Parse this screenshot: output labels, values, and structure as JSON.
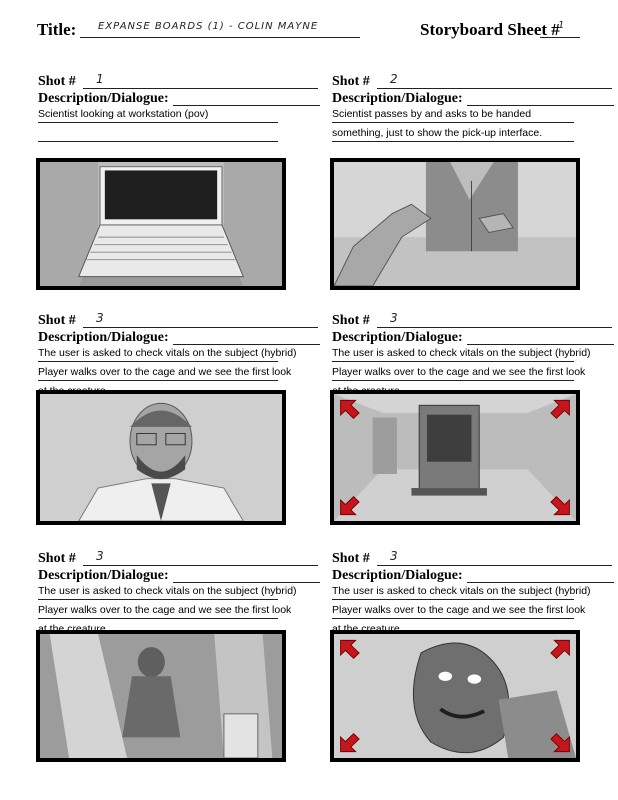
{
  "header": {
    "title_label": "Title:",
    "title_value": "EXPANSE BOARDS (1)  - COLIN MAYNE",
    "sheet_label": "Storyboard Sheet #",
    "sheet_value": "1"
  },
  "desc_label": "Description/Dialogue:",
  "shot_label": "Shot #",
  "shots": [
    {
      "number": "1",
      "lines": [
        "Scientist looking at workstation (pov)",
        ""
      ],
      "art": "laptop"
    },
    {
      "number": "2",
      "lines": [
        "Scientist passes by and asks to be handed",
        "something, just to show the pick-up interface."
      ],
      "art": "hand-reach"
    },
    {
      "number": "3",
      "lines": [
        "The user is asked to check vitals on the subject (hybrid)",
        "Player walks over to the cage and we see the first look",
        "at the creature."
      ],
      "art": "scientist-portrait"
    },
    {
      "number": "3",
      "lines": [
        "The user is asked to check vitals on the subject (hybrid)",
        "Player walks over to the cage and we see the first look",
        "at the creature."
      ],
      "art": "cage-room"
    },
    {
      "number": "3",
      "lines": [
        "The user is asked to check vitals on the subject (hybrid)",
        "Player walks over to the cage and we see the first look",
        "at the creature."
      ],
      "art": "creature-silhouette"
    },
    {
      "number": "3",
      "lines": [
        "The user is asked to check vitals on the subject (hybrid)",
        "Player walks over to the cage and we see the first look",
        "at the creature."
      ],
      "art": "creature-closeup"
    }
  ]
}
